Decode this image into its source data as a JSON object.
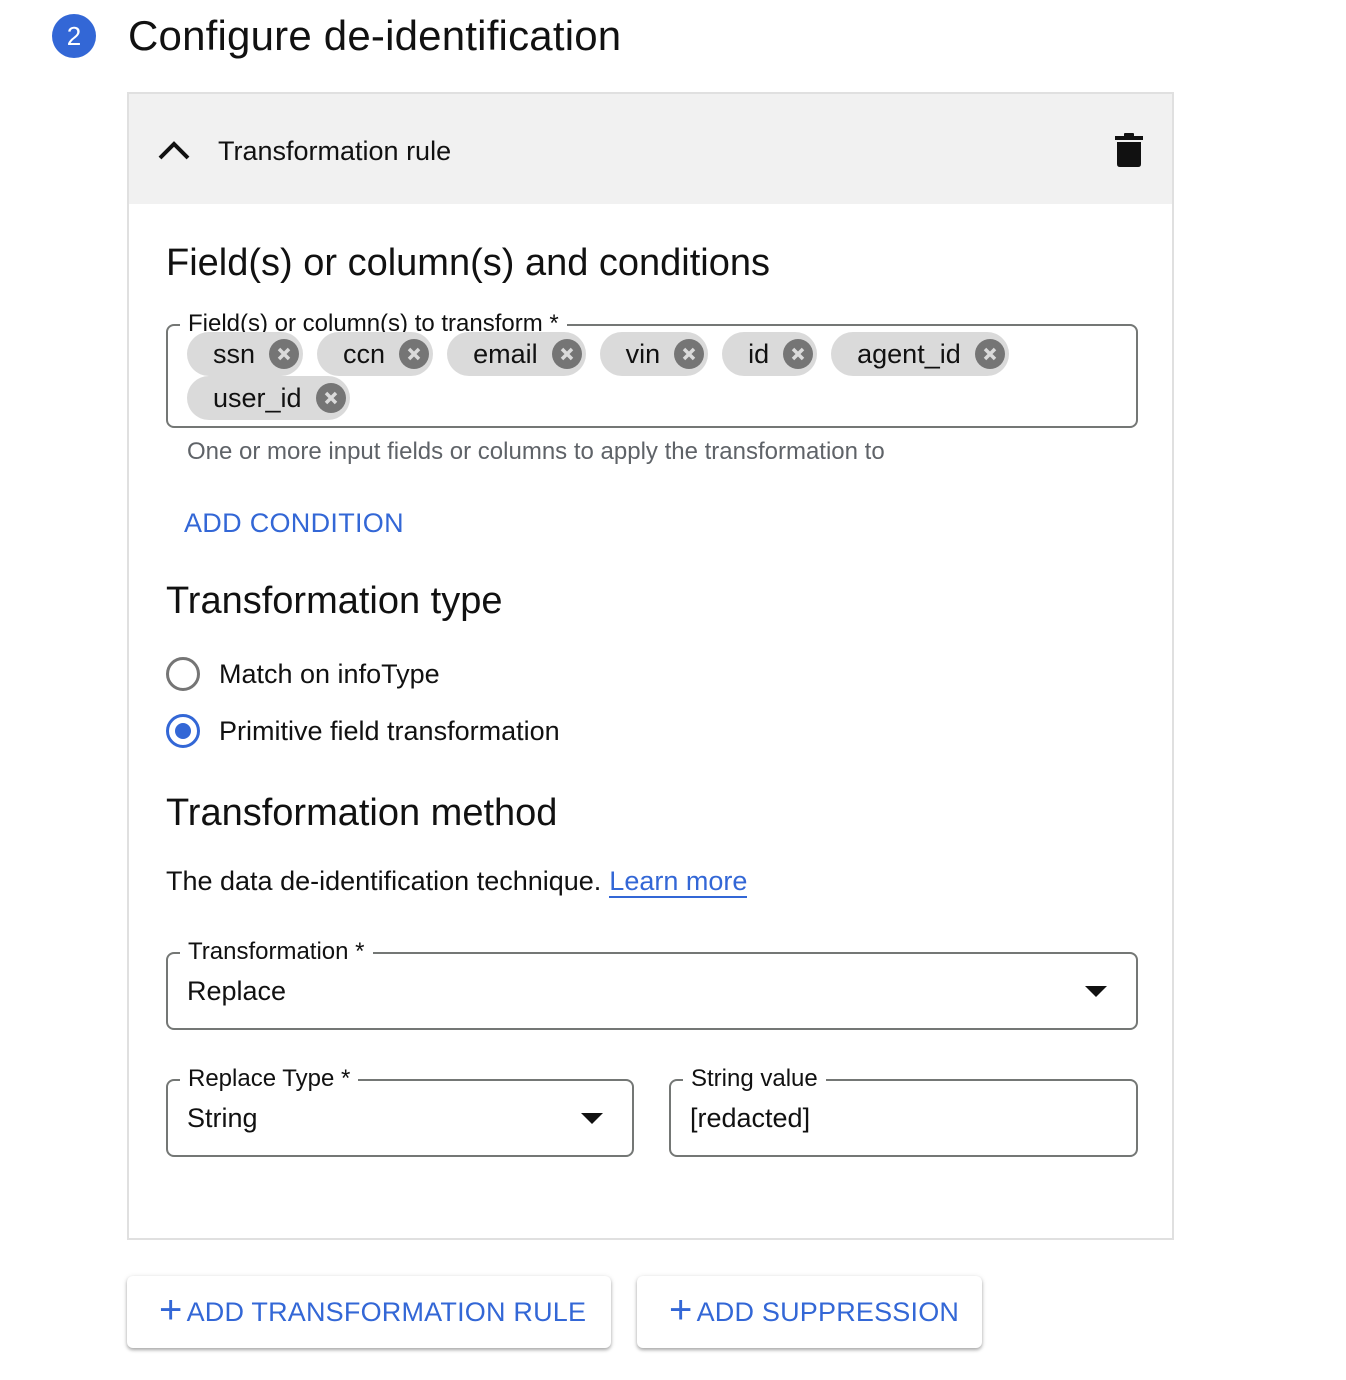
{
  "step": {
    "number": "2",
    "title": "Configure de-identification",
    "accent_color": "#3367d6"
  },
  "rule": {
    "title": "Transformation rule",
    "collapse_icon": "chevron-up-icon",
    "delete_icon": "trash-icon",
    "fields_section": {
      "heading": "Field(s) or column(s) and conditions",
      "input_label": "Field(s) or column(s) to transform *",
      "chips": [
        "ssn",
        "ccn",
        "email",
        "vin",
        "id",
        "agent_id",
        "user_id"
      ],
      "helper_text": "One or more input fields or columns to apply the transformation to",
      "add_condition_label": "ADD CONDITION"
    },
    "type_section": {
      "heading": "Transformation type",
      "options": [
        {
          "label": "Match on infoType",
          "selected": false
        },
        {
          "label": "Primitive field transformation",
          "selected": true
        }
      ]
    },
    "method_section": {
      "heading": "Transformation method",
      "description": "The data de-identification technique.",
      "learn_more_label": "Learn more",
      "transformation": {
        "label": "Transformation *",
        "value": "Replace"
      },
      "replace_type": {
        "label": "Replace Type *",
        "value": "String"
      },
      "string_value": {
        "label": "String value",
        "value": "[redacted]"
      }
    }
  },
  "actions": {
    "add_rule_label": "ADD TRANSFORMATION RULE",
    "add_suppression_label": "ADD SUPPRESSION",
    "plus_symbol": "+"
  }
}
